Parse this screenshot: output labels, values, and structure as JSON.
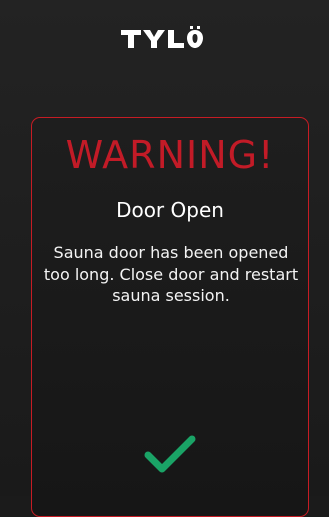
{
  "brand": {
    "name": "TYLÖ",
    "logo_color": "#ffffff"
  },
  "dialog": {
    "title": "WARNING!",
    "subtitle": "Door Open",
    "message": "Sauna door has been opened too long. Close door and restart sauna session.",
    "confirm_icon": "checkmark-icon",
    "accent_color": "#c61c24",
    "confirm_color": "#1aa366"
  }
}
